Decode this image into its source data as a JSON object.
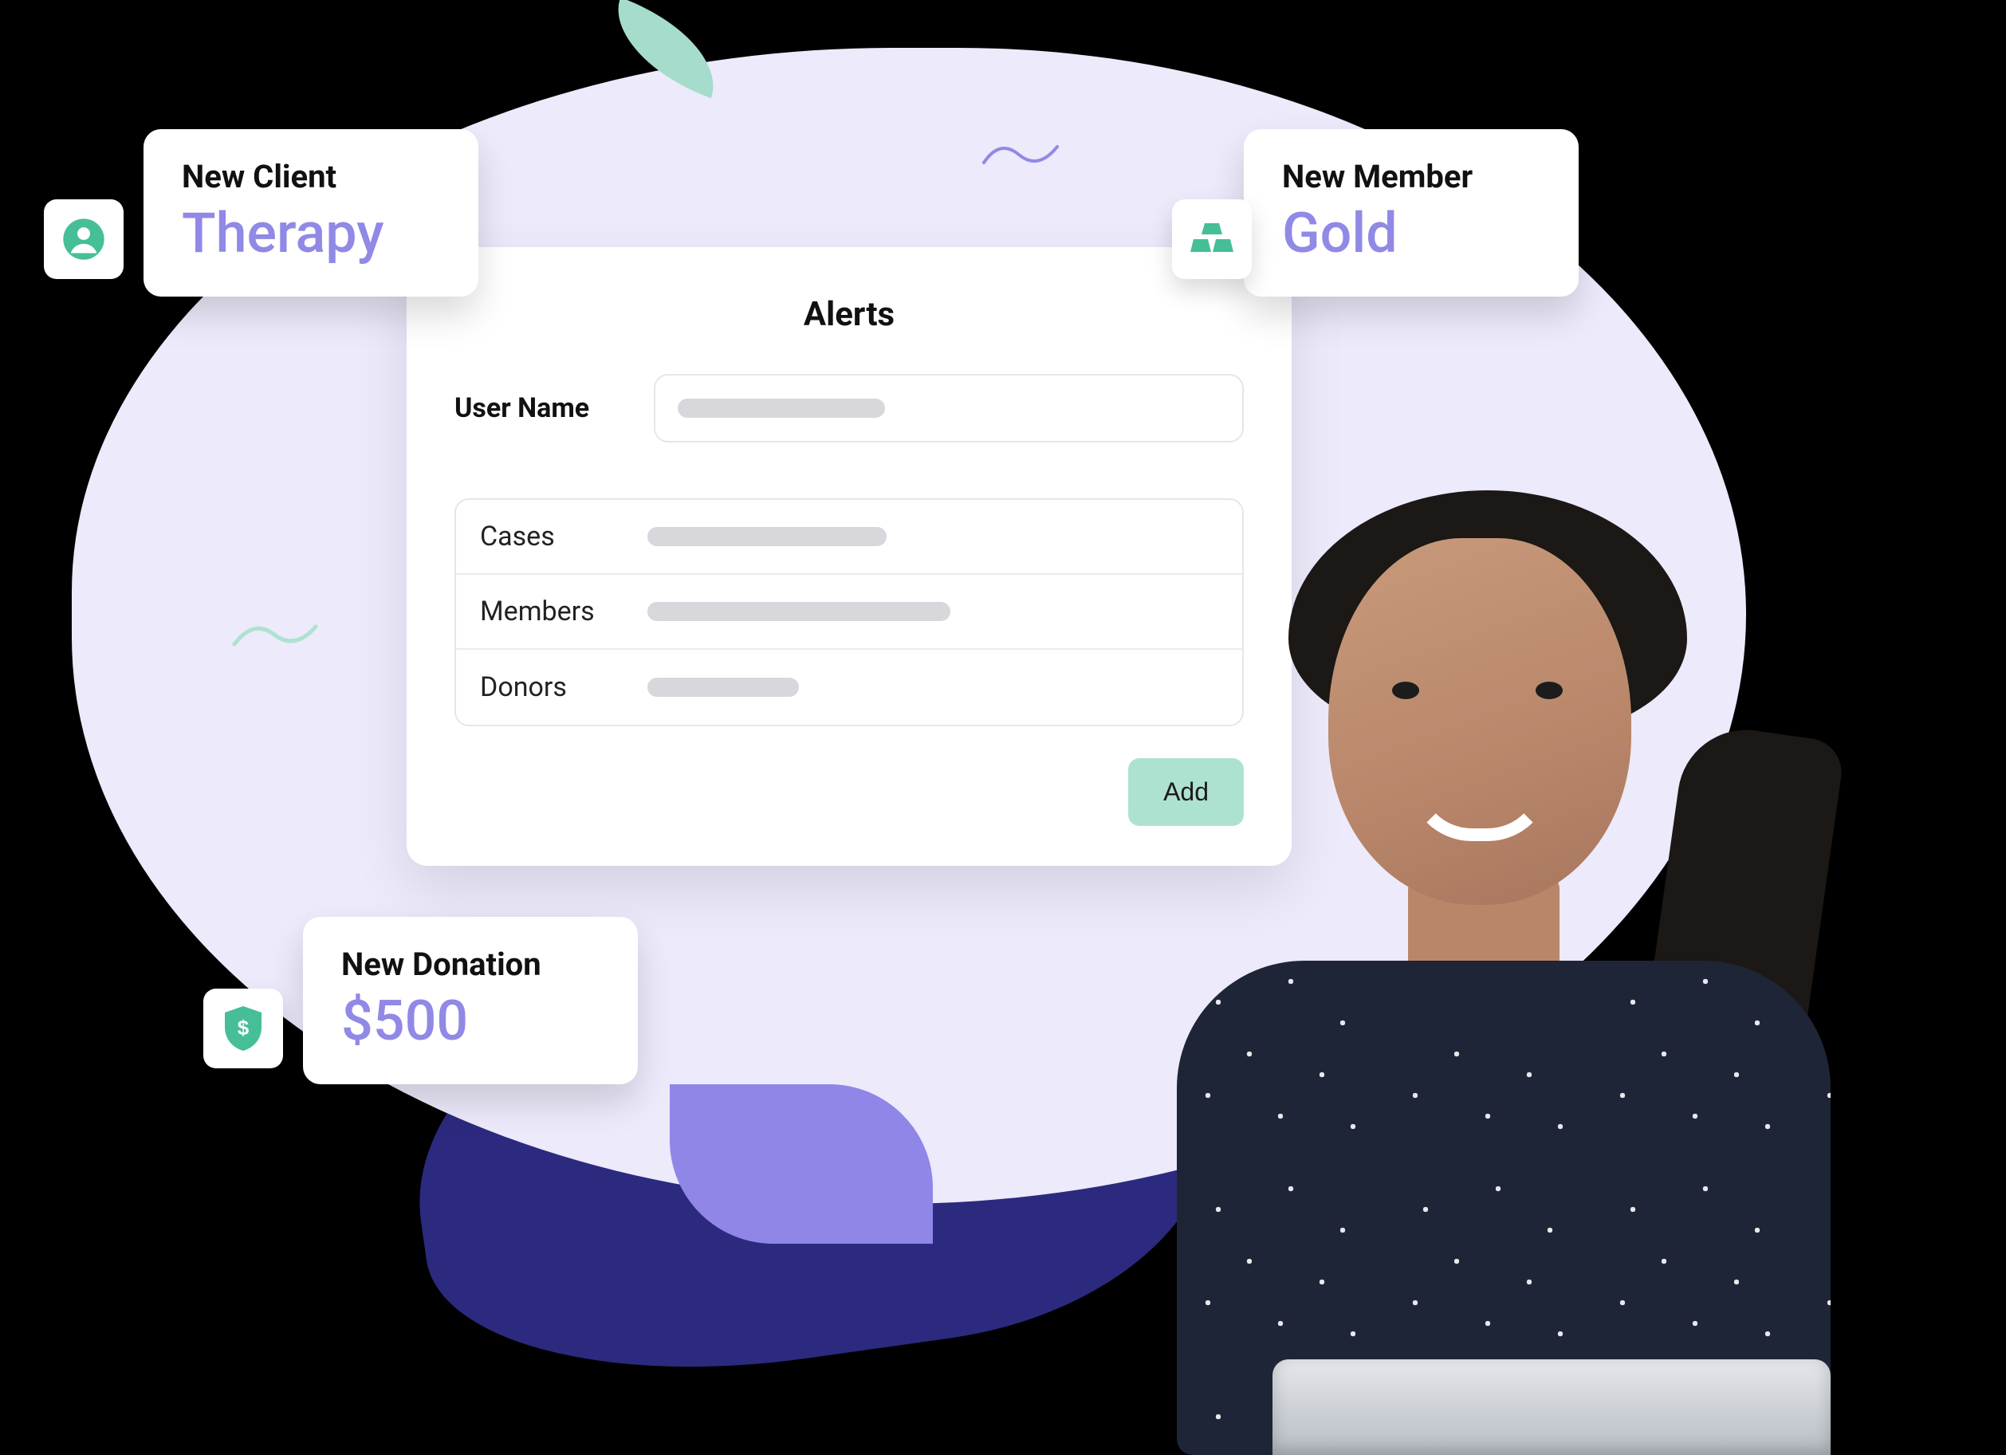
{
  "colors": {
    "accent_purple": "#9089E6",
    "accent_teal": "#46BE97",
    "mint_button": "#AEE2D0",
    "blob": "#ECEAFB"
  },
  "cards": {
    "client": {
      "title": "New Client",
      "value": "Therapy",
      "icon": "person-circle-icon"
    },
    "member": {
      "title": "New Member",
      "value": "Gold",
      "icon": "gold-bars-icon"
    },
    "donation": {
      "title": "New Donation",
      "value": "$500",
      "icon": "donation-shield-icon"
    }
  },
  "panel": {
    "title": "Alerts",
    "username_label": "User Name",
    "list": [
      {
        "label": "Cases"
      },
      {
        "label": "Members"
      },
      {
        "label": "Donors"
      }
    ],
    "add_button": "Add"
  }
}
